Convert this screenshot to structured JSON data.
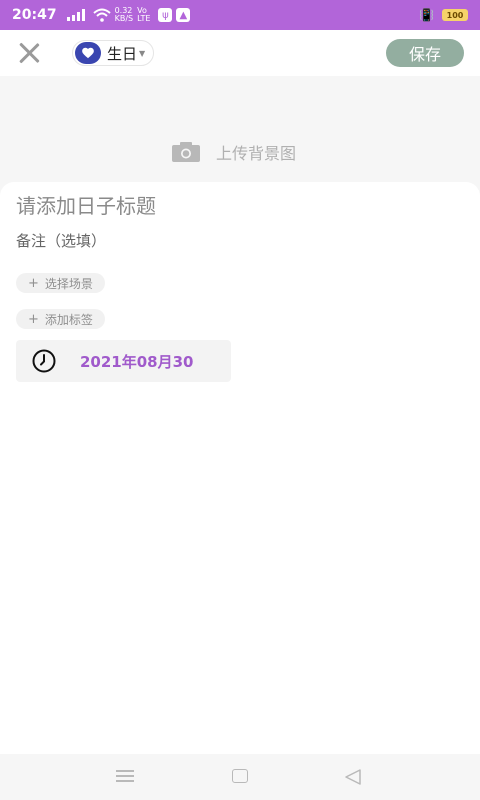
{
  "status_bar": {
    "time": "20:47",
    "speed_top": "0.32",
    "speed_bottom": "KB/S",
    "volte_top": "Vo",
    "volte_bottom": "LTE",
    "battery": "100"
  },
  "top_bar": {
    "category_label": "生日",
    "save_label": "保存",
    "colors": {
      "save_button": "#93aea0",
      "accent": "#b265d9"
    }
  },
  "background": {
    "upload_label": "上传背景图"
  },
  "form": {
    "title_placeholder": "请添加日子标题",
    "note_placeholder": "备注（选填）",
    "scene_chip": "选择场景",
    "tag_chip": "添加标签",
    "chip_plus": "+",
    "date": "2021年08月30"
  }
}
